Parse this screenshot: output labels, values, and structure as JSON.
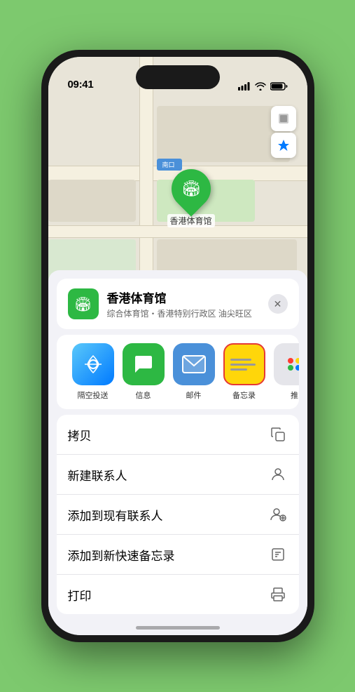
{
  "status_bar": {
    "time": "09:41",
    "signal_icon": "signal",
    "wifi_icon": "wifi",
    "battery_icon": "battery"
  },
  "map": {
    "south_entrance_label": "南口",
    "location_name": "香港体育馆",
    "map_control_layers": "🗺",
    "map_control_location": "➤"
  },
  "venue_card": {
    "name": "香港体育馆",
    "subtitle": "综合体育馆・香港特别行政区 油尖旺区",
    "close_label": "×"
  },
  "share_items": [
    {
      "id": "airdrop",
      "label": "隔空投送",
      "type": "airdrop"
    },
    {
      "id": "messages",
      "label": "信息",
      "type": "messages"
    },
    {
      "id": "mail",
      "label": "邮件",
      "type": "mail"
    },
    {
      "id": "notes",
      "label": "备忘录",
      "type": "notes"
    },
    {
      "id": "more",
      "label": "推",
      "type": "more"
    }
  ],
  "actions": [
    {
      "id": "copy",
      "label": "拷贝",
      "icon": "copy"
    },
    {
      "id": "new-contact",
      "label": "新建联系人",
      "icon": "person"
    },
    {
      "id": "add-existing",
      "label": "添加到现有联系人",
      "icon": "person-add"
    },
    {
      "id": "add-notes",
      "label": "添加到新快速备忘录",
      "icon": "note-add"
    },
    {
      "id": "print",
      "label": "打印",
      "icon": "print"
    }
  ]
}
